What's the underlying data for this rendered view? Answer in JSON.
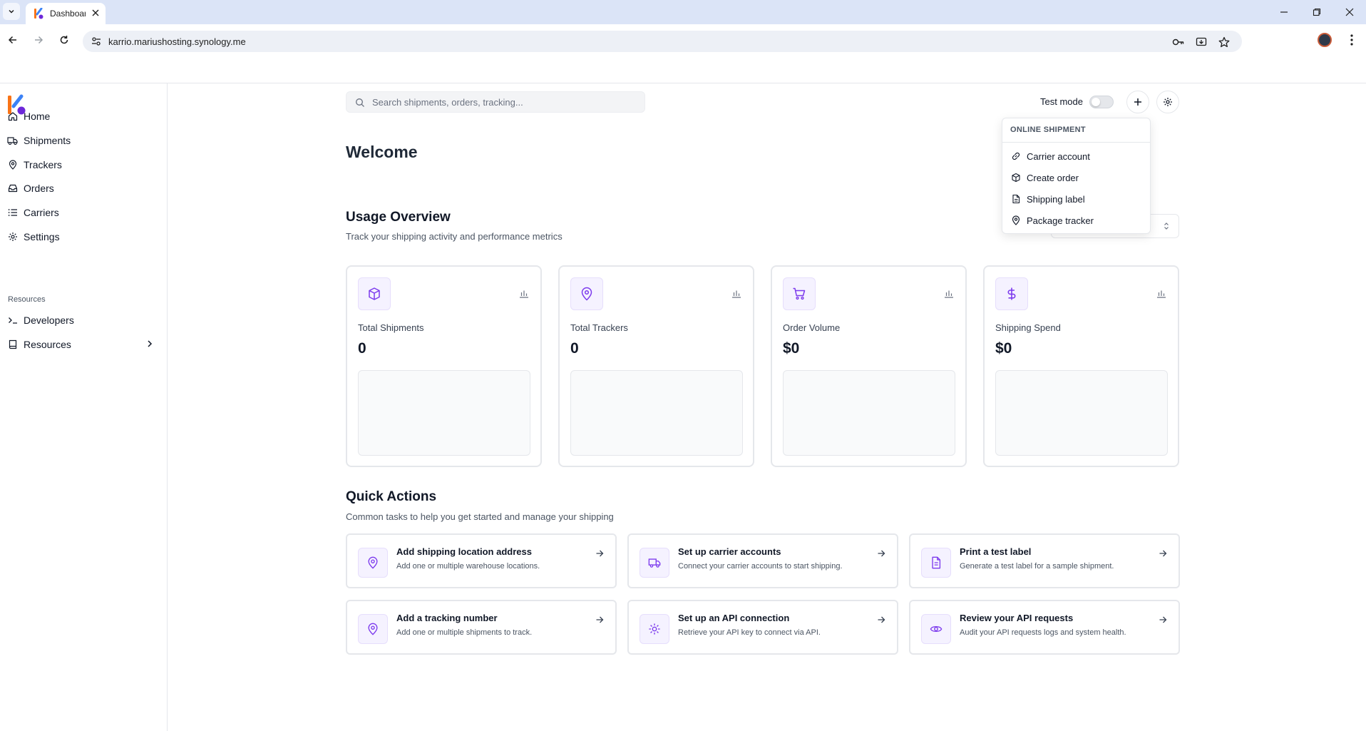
{
  "browser": {
    "tab_title": "Dashboard",
    "url": "karrio.mariushosting.synology.me"
  },
  "sidebar": {
    "items": [
      {
        "label": "Home",
        "icon": "home-icon"
      },
      {
        "label": "Shipments",
        "icon": "truck-icon"
      },
      {
        "label": "Trackers",
        "icon": "map-pin-icon"
      },
      {
        "label": "Orders",
        "icon": "inbox-icon"
      },
      {
        "label": "Carriers",
        "icon": "list-icon"
      },
      {
        "label": "Settings",
        "icon": "gear-icon"
      }
    ],
    "section_label": "Resources",
    "resource_items": [
      {
        "label": "Developers",
        "icon": "terminal-icon"
      },
      {
        "label": "Resources",
        "icon": "book-icon"
      }
    ]
  },
  "header": {
    "search_placeholder": "Search shipments, orders, tracking...",
    "test_mode_label": "Test mode",
    "test_mode_enabled": false
  },
  "main": {
    "welcome": "Welcome",
    "usage": {
      "title": "Usage Overview",
      "subtitle": "Track your shipping activity and performance metrics",
      "cards": [
        {
          "label": "Total Shipments",
          "value": "0",
          "icon": "package-icon"
        },
        {
          "label": "Total Trackers",
          "value": "0",
          "icon": "map-pin-icon"
        },
        {
          "label": "Order Volume",
          "value": "$0",
          "icon": "cart-icon"
        },
        {
          "label": "Shipping Spend",
          "value": "$0",
          "icon": "dollar-icon"
        }
      ]
    },
    "quick_actions": {
      "title": "Quick Actions",
      "subtitle": "Common tasks to help you get started and manage your shipping",
      "items": [
        {
          "title": "Add shipping location address",
          "desc": "Add one or multiple warehouse locations.",
          "icon": "map-pin-icon"
        },
        {
          "title": "Set up carrier accounts",
          "desc": "Connect your carrier accounts to start shipping.",
          "icon": "truck-icon"
        },
        {
          "title": "Print a test label",
          "desc": "Generate a test label for a sample shipment.",
          "icon": "file-icon"
        },
        {
          "title": "Add a tracking number",
          "desc": "Add one or multiple shipments to track.",
          "icon": "map-pin-icon"
        },
        {
          "title": "Set up an API connection",
          "desc": "Retrieve your API key to connect via API.",
          "icon": "gear-icon"
        },
        {
          "title": "Review your API requests",
          "desc": "Audit your API requests logs and system health.",
          "icon": "eye-icon"
        }
      ]
    }
  },
  "dropdown": {
    "header": "ONLINE SHIPMENT",
    "items": [
      {
        "label": "Carrier account",
        "icon": "link-icon"
      },
      {
        "label": "Create order",
        "icon": "package-icon"
      },
      {
        "label": "Shipping label",
        "icon": "file-icon"
      },
      {
        "label": "Package tracker",
        "icon": "map-pin-icon"
      }
    ]
  },
  "colors": {
    "accent": "#7c3aed",
    "icon_bg": "#f5f2ff",
    "border": "#e5e7eb"
  }
}
